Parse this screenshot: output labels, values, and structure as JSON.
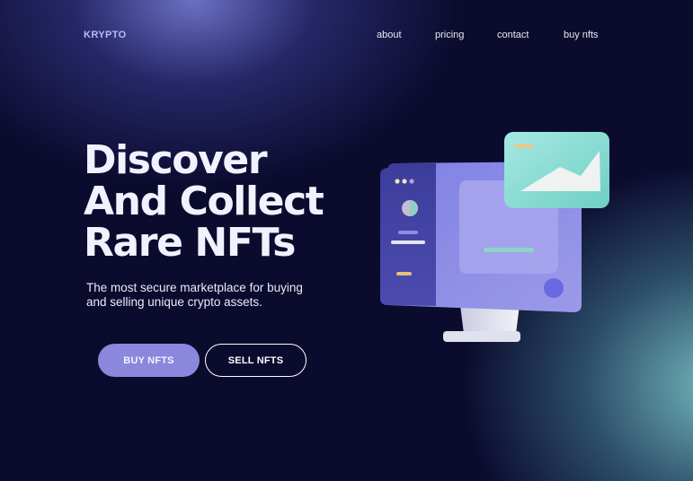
{
  "brand": {
    "logo": "KRYPTO"
  },
  "nav": {
    "items": [
      "about",
      "pricing",
      "contact",
      "buy nfts"
    ]
  },
  "hero": {
    "headline_lines": [
      "Discover",
      "And Collect",
      "Rare NFTs"
    ],
    "subtitle": "The most secure marketplace for buying and selling unique crypto assets.",
    "buttons": {
      "primary": "BUY NFTS",
      "secondary": "SELL NFTS"
    }
  },
  "colors": {
    "background": "#0b0b2e",
    "accent": "#8a87dc",
    "logo": "#b7baf2",
    "teal": "#7fd6cf"
  },
  "illustration": {
    "icon": "computer-monitor-with-image-card-icon"
  }
}
